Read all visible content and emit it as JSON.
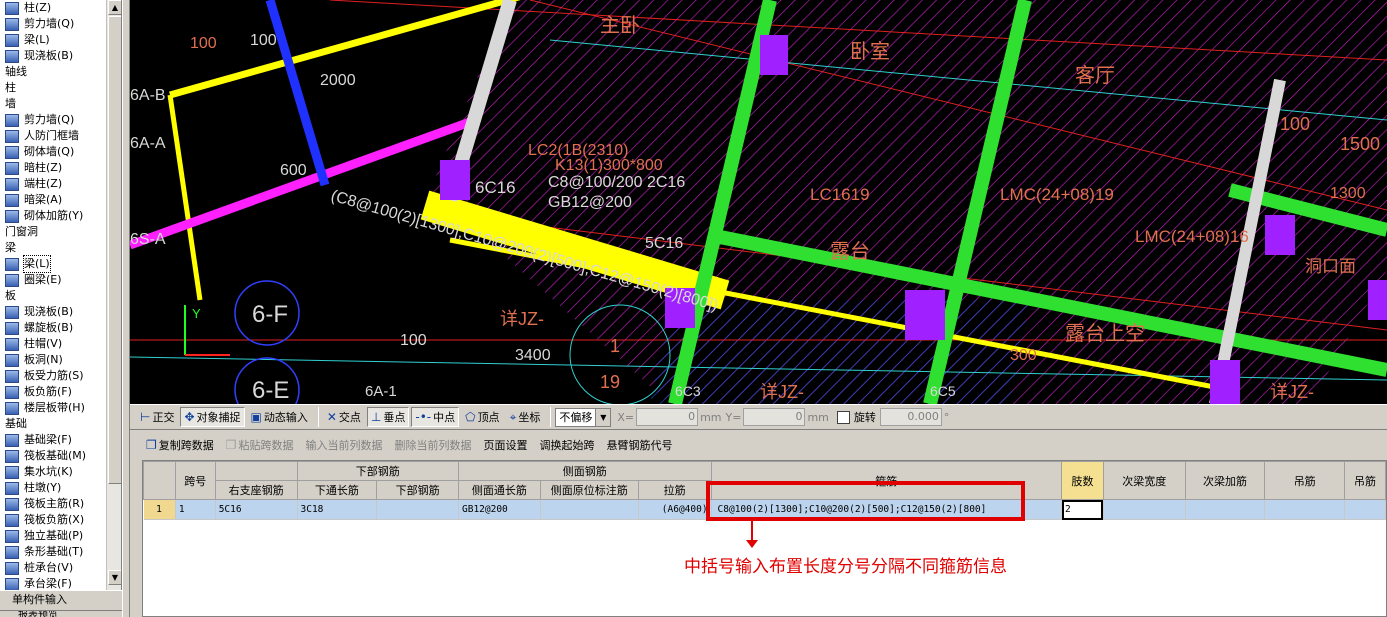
{
  "tree": {
    "items": [
      {
        "label": "柱(Z)",
        "type": "item"
      },
      {
        "label": "剪力墙(Q)",
        "type": "item"
      },
      {
        "label": "梁(L)",
        "type": "item"
      },
      {
        "label": "现浇板(B)",
        "type": "item"
      },
      {
        "label": "轴线",
        "type": "cat"
      },
      {
        "label": "柱",
        "type": "cat"
      },
      {
        "label": "墙",
        "type": "cat"
      },
      {
        "label": "剪力墙(Q)",
        "type": "item"
      },
      {
        "label": "人防门框墙",
        "type": "item"
      },
      {
        "label": "砌体墙(Q)",
        "type": "item"
      },
      {
        "label": "暗柱(Z)",
        "type": "item"
      },
      {
        "label": "端柱(Z)",
        "type": "item"
      },
      {
        "label": "暗梁(A)",
        "type": "item"
      },
      {
        "label": "砌体加筋(Y)",
        "type": "item"
      },
      {
        "label": "门窗洞",
        "type": "cat"
      },
      {
        "label": "梁",
        "type": "cat"
      },
      {
        "label": "梁(L)",
        "type": "item",
        "selected": true
      },
      {
        "label": "圈梁(E)",
        "type": "item"
      },
      {
        "label": "板",
        "type": "cat"
      },
      {
        "label": "现浇板(B)",
        "type": "item"
      },
      {
        "label": "螺旋板(B)",
        "type": "item"
      },
      {
        "label": "柱帽(V)",
        "type": "item"
      },
      {
        "label": "板洞(N)",
        "type": "item"
      },
      {
        "label": "板受力筋(S)",
        "type": "item"
      },
      {
        "label": "板负筋(F)",
        "type": "item"
      },
      {
        "label": "楼层板带(H)",
        "type": "item"
      },
      {
        "label": "基础",
        "type": "cat"
      },
      {
        "label": "基础梁(F)",
        "type": "item"
      },
      {
        "label": "筏板基础(M)",
        "type": "item"
      },
      {
        "label": "集水坑(K)",
        "type": "item"
      },
      {
        "label": "柱墩(Y)",
        "type": "item"
      },
      {
        "label": "筏板主筋(R)",
        "type": "item"
      },
      {
        "label": "筏板负筋(X)",
        "type": "item"
      },
      {
        "label": "独立基础(P)",
        "type": "item"
      },
      {
        "label": "条形基础(T)",
        "type": "item"
      },
      {
        "label": "桩承台(V)",
        "type": "item"
      },
      {
        "label": "承台梁(F)",
        "type": "item"
      }
    ],
    "bottom_tab": "单构件输入",
    "bottom_tab2": "报表预览"
  },
  "cad": {
    "labels": {
      "room1": "主卧",
      "room2": "卧室",
      "room3": "客厅",
      "room4": "露台",
      "room5": "露台上空",
      "axis_6b": "6A-B",
      "axis_6a": "6A-A",
      "axis_5": "6S-A",
      "axis_6f": "6-F",
      "axis_6e": "6-E",
      "axis_6a1": "6A-1",
      "b1": "6C16",
      "b2": "(C8@100(2)[1300];C10@200(2)[500];C12@150(2)[800])",
      "b3": "C8@100/200 2C16",
      "b4": "GB12@200",
      "b5": "5C16",
      "b6": "LC2(1B(2310)",
      "b7": "K13(1)300*800",
      "b8": "LC1619",
      "b9": "LMC(24+08)19",
      "b10": "LMC(24+08)16",
      "b11": "洞口面",
      "d1": "100",
      "d2": "100",
      "d3": "2000",
      "d4": "600",
      "d5": "100",
      "d6": "3400",
      "d7": "1",
      "d8": "19",
      "d9": "1500",
      "d10": "100",
      "d11": "300",
      "d12": "1300",
      "d13": "6C3",
      "d14": "6C5",
      "x1": "详JZ-",
      "x2": "详JZ-",
      "x3": "详JZ-",
      "y": "Y"
    }
  },
  "snapbar": {
    "items": [
      "正交",
      "对象捕捉",
      "动态输入",
      "交点",
      "垂点",
      "中点",
      "顶点",
      "坐标"
    ],
    "offset_mode": "不偏移",
    "x_label": "X=",
    "x_value": "0",
    "x_unit": "mm",
    "y_label": "Y=",
    "y_value": "0",
    "y_unit": "mm",
    "rotate_label": "旋转",
    "rotate_value": "0.000",
    "deg": "°"
  },
  "gridbar": {
    "copy": "复制跨数据",
    "paste": "粘贴跨数据",
    "input_col": "输入当前列数据",
    "del_col": "删除当前列数据",
    "page": "页面设置",
    "swap": "调换起始跨",
    "cant": "悬臂钢筋代号"
  },
  "grid": {
    "group_headers": {
      "bottom": "下部钢筋",
      "side": "侧面钢筋",
      "stirrup": "箍筋"
    },
    "headers": {
      "span": "跨号",
      "right_seat": "右支座钢筋",
      "bottom_thru": "下通长筋",
      "bottom_bar": "下部钢筋",
      "side_thru": "侧面通长筋",
      "side_orig": "侧面原位标注筋",
      "tie": "拉筋",
      "stirrup": "箍筋",
      "legs": "肢数",
      "sec_width": "次梁宽度",
      "sec_add": "次梁加筋",
      "hanger": "吊筋",
      "hanger2": "吊筋"
    },
    "rows": [
      {
        "num": "1",
        "span": "1",
        "right_seat": "5C16",
        "bottom_thru": "3C18",
        "bottom_bar": "",
        "side_thru": "GB12@200",
        "side_orig": "",
        "tie": "(A6@400)",
        "stirrup": "C8@100(2)[1300];C10@200(2)[500];C12@150(2)[800]",
        "legs": "2",
        "sec_width": "",
        "sec_add": "",
        "hanger": "",
        "hanger2": ""
      }
    ]
  },
  "annotation": {
    "text": "中括号输入布置长度分号分隔不同箍筋信息"
  }
}
